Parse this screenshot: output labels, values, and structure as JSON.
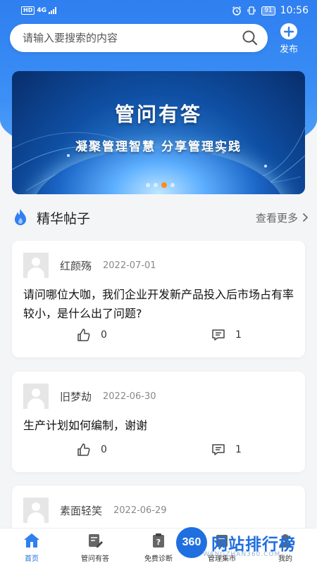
{
  "status_bar": {
    "left_badge": "HD",
    "network": "4G",
    "battery": "91",
    "time": "10:56"
  },
  "search": {
    "placeholder": "请输入要搜索的内容"
  },
  "publish": {
    "label": "发布"
  },
  "banner": {
    "title": "管问有答",
    "subtitle": "凝聚管理智慧  分享管理实践",
    "slide_count": 4,
    "active_slide": 2
  },
  "section": {
    "title": "精华帖子",
    "more": "查看更多"
  },
  "posts": [
    {
      "author": "红颜殇",
      "date": "2022-07-01",
      "content": "请问哪位大咖，我们企业开发新产品投入后市场占有率较小，是什么出了问题?",
      "likes": "0",
      "comments": "1"
    },
    {
      "author": "旧梦劫",
      "date": "2022-06-30",
      "content": "生产计划如何编制，谢谢",
      "likes": "0",
      "comments": "1"
    },
    {
      "author": "素面轻笑",
      "date": "2022-06-29",
      "content": "",
      "likes": "",
      "comments": ""
    }
  ],
  "tabs": [
    {
      "label": "首页",
      "icon": "home-icon",
      "active": true
    },
    {
      "label": "管问有答",
      "icon": "edit-doc-icon",
      "active": false
    },
    {
      "label": "免费诊断",
      "icon": "question-clipboard-icon",
      "active": false
    },
    {
      "label": "管理集市",
      "icon": "market-icon",
      "active": false
    },
    {
      "label": "我的",
      "icon": "user-icon",
      "active": false
    }
  ],
  "watermark": {
    "logo": "360",
    "text": "网站排行榜",
    "sub": "WANGZHAN360.COM"
  },
  "colors": {
    "primary": "#2f7ff0",
    "accent": "#ff8a1f",
    "watermark": "#1f6fe0"
  }
}
